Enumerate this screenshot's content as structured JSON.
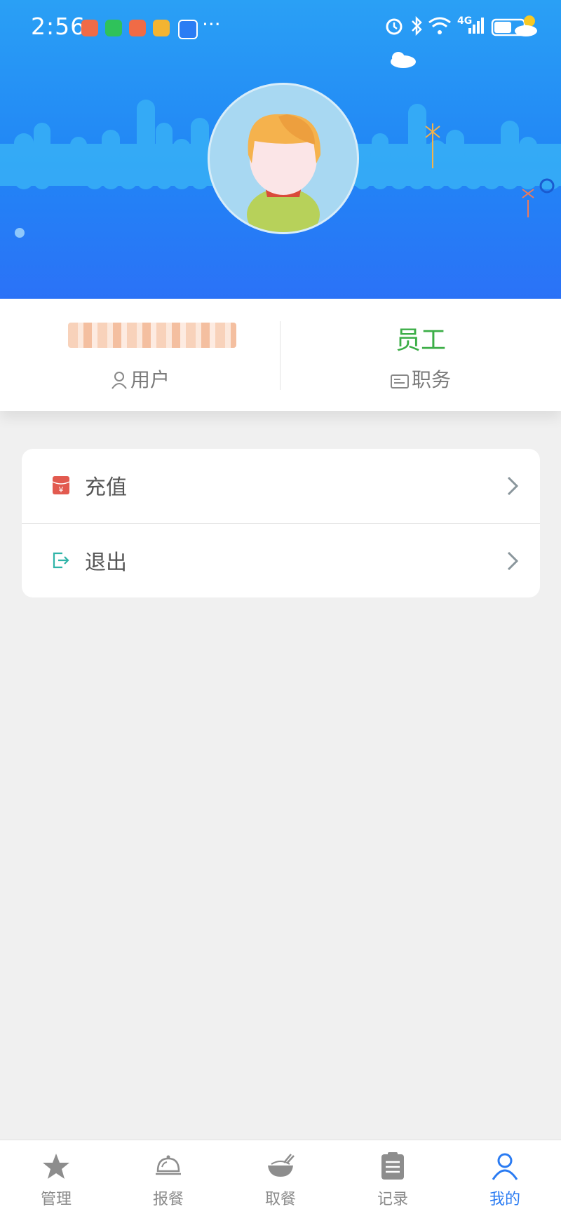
{
  "status_bar": {
    "time": "2:56",
    "network": "4G",
    "icons": [
      "app-notification-icon",
      "wechat-icon",
      "app-notification-icon",
      "app-icon",
      "weather-icon",
      "alarm-icon",
      "bluetooth-icon",
      "wifi-icon",
      "signal-icon",
      "battery-icon"
    ]
  },
  "profile": {
    "user_label": "用户",
    "role_value": "员工",
    "role_label": "职务",
    "colors": {
      "role": "#3cae47",
      "header_top": "#2aa0f5",
      "header_bottom": "#2b72f7"
    }
  },
  "menu": {
    "items": [
      {
        "label": "充值",
        "icon": "red-envelope-icon"
      },
      {
        "label": "退出",
        "icon": "logout-icon"
      }
    ]
  },
  "tabbar": {
    "active_color": "#2a7bf2",
    "tabs": [
      {
        "label": "管理",
        "icon": "star-icon"
      },
      {
        "label": "报餐",
        "icon": "cloche-icon"
      },
      {
        "label": "取餐",
        "icon": "bowl-icon"
      },
      {
        "label": "记录",
        "icon": "clipboard-icon"
      },
      {
        "label": "我的",
        "icon": "user-icon",
        "active": true
      }
    ]
  }
}
